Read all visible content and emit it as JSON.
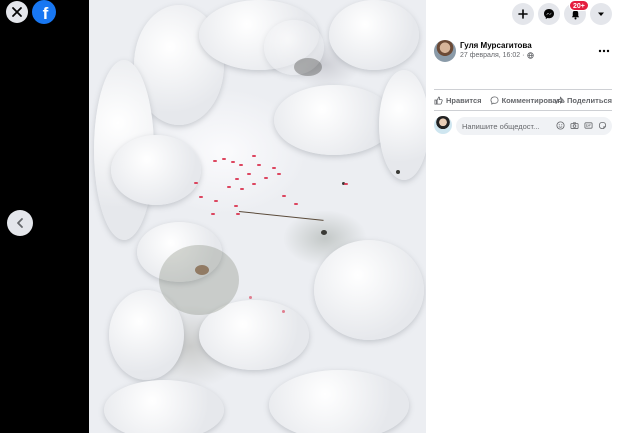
{
  "viewer": {
    "close_icon": "close-icon",
    "logo_icon": "facebook-logo",
    "logo_letter": "f",
    "prev_icon": "chevron-left-icon"
  },
  "header": {
    "buttons": [
      "plus-icon",
      "messenger-icon",
      "bell-icon",
      "caret-down-icon"
    ],
    "notification_count": "20+",
    "notification_color": "#e41e3f"
  },
  "post": {
    "author_name": "Гуля Мурсагитова",
    "timestamp": "27 февраля, 16:02",
    "privacy_icon": "globe-icon",
    "more_icon": "more-icon"
  },
  "actions": {
    "like_label": "Нравится",
    "comment_label": "Комментировать",
    "share_label": "Поделиться"
  },
  "comment": {
    "placeholder": "Напишите общедост...",
    "icons": [
      "emoji-icon",
      "camera-icon",
      "gif-icon",
      "sticker-icon"
    ]
  },
  "colors": {
    "brand": "#1877f2",
    "muted_text": "#65676b",
    "button_bg": "#e4e6eb"
  }
}
